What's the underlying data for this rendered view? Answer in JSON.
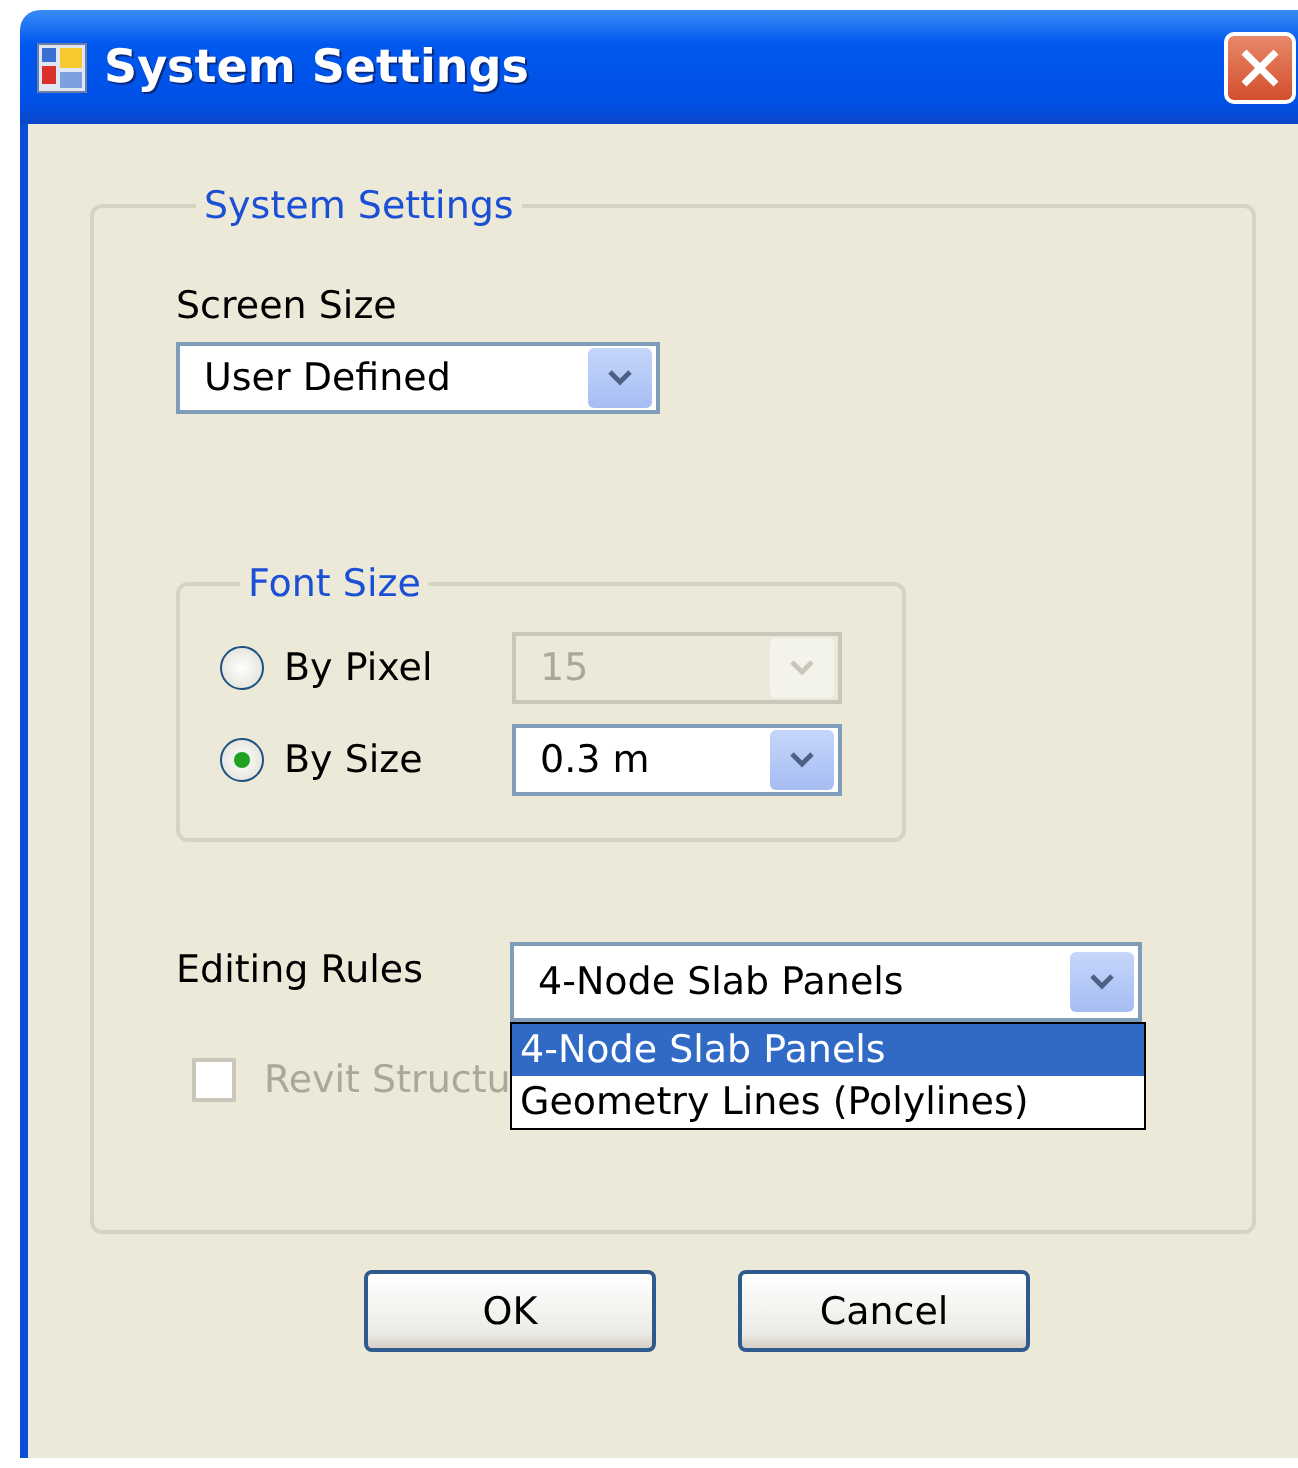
{
  "window": {
    "title": "System Settings"
  },
  "group": {
    "title": "System Settings"
  },
  "screen_size": {
    "label": "Screen Size",
    "value": "User Defined"
  },
  "font_size": {
    "title": "Font Size",
    "options": [
      {
        "label": "By Pixel",
        "selected": false,
        "value": "15",
        "disabled": true
      },
      {
        "label": "By Size",
        "selected": true,
        "value": "0.3 m",
        "disabled": false
      }
    ]
  },
  "editing_rules": {
    "label": "Editing Rules",
    "value": "4-Node Slab Panels",
    "expanded": true,
    "options": [
      {
        "label": "4-Node Slab Panels",
        "selected": true
      },
      {
        "label": "Geometry Lines (Polylines)",
        "selected": false
      }
    ]
  },
  "checkbox": {
    "label": "Revit Structu",
    "checked": false,
    "disabled": true
  },
  "buttons": [
    {
      "label": "OK"
    },
    {
      "label": "Cancel"
    }
  ]
}
